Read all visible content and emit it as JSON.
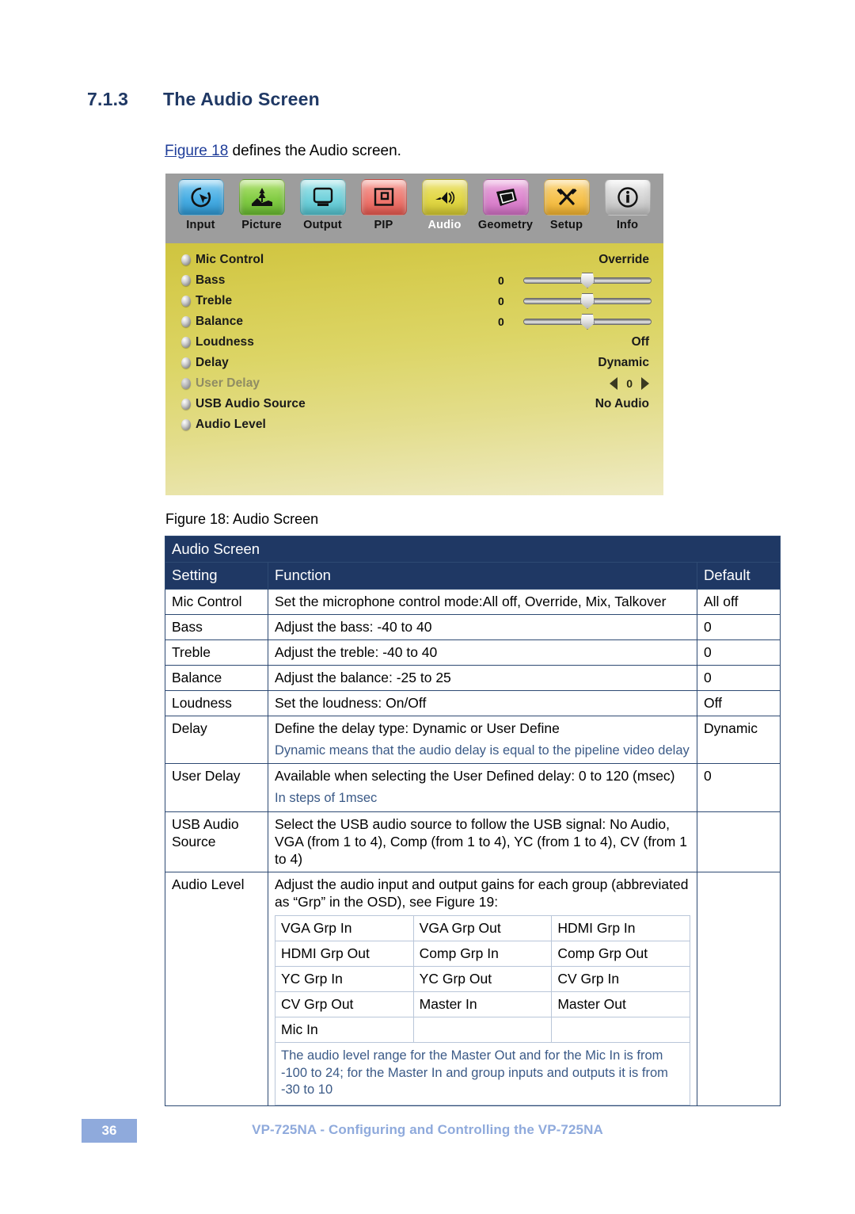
{
  "heading": {
    "number": "7.1.3",
    "title": "The Audio Screen"
  },
  "intro": {
    "link": "Figure 18",
    "rest": " defines the Audio screen."
  },
  "osd": {
    "tabs": [
      {
        "label": "Input",
        "icon": "cursor-target-icon",
        "active": false
      },
      {
        "label": "Picture",
        "icon": "landscape-tree-icon",
        "active": false
      },
      {
        "label": "Output",
        "icon": "monitor-icon",
        "active": false
      },
      {
        "label": "PIP",
        "icon": "picture-in-picture-icon",
        "active": false
      },
      {
        "label": "Audio",
        "icon": "speaker-icon",
        "active": true
      },
      {
        "label": "Geometry",
        "icon": "keystone-shape-icon",
        "active": false
      },
      {
        "label": "Setup",
        "icon": "tools-icon",
        "active": false
      },
      {
        "label": "Info",
        "icon": "info-circle-icon",
        "active": false
      }
    ],
    "rows": [
      {
        "label": "Mic Control",
        "value": "Override",
        "control": "text",
        "dim": false
      },
      {
        "label": "Bass",
        "num": "0",
        "control": "slider",
        "dim": false
      },
      {
        "label": "Treble",
        "num": "0",
        "control": "slider",
        "dim": false
      },
      {
        "label": "Balance",
        "num": "0",
        "control": "slider",
        "dim": false
      },
      {
        "label": "Loudness",
        "value": "Off",
        "control": "text",
        "dim": false
      },
      {
        "label": "Delay",
        "value": "Dynamic",
        "control": "text",
        "dim": false
      },
      {
        "label": "User Delay",
        "stepper": "0",
        "control": "stepper",
        "dim": true
      },
      {
        "label": "USB Audio Source",
        "value": "No Audio",
        "control": "text",
        "dim": false
      },
      {
        "label": "Audio Level",
        "value": "",
        "control": "none",
        "dim": false
      }
    ]
  },
  "figure_caption": "Figure 18: Audio Screen",
  "table": {
    "title": "Audio Screen",
    "headers": {
      "setting": "Setting",
      "function": "Function",
      "default": "Default"
    },
    "rows": [
      {
        "setting": "Mic Control",
        "function": "Set the microphone control mode:All off, Override, Mix, Talkover",
        "default": "All off"
      },
      {
        "setting": "Bass",
        "function": "Adjust the bass: -40 to 40",
        "default": "0"
      },
      {
        "setting": "Treble",
        "function": "Adjust the treble: -40 to 40",
        "default": "0"
      },
      {
        "setting": "Balance",
        "function": "Adjust the balance: -25 to 25",
        "default": "0"
      },
      {
        "setting": "Loudness",
        "function": "Set the loudness: On/Off",
        "default": "Off"
      },
      {
        "setting": "Delay",
        "function": "Define the delay type: Dynamic or User Define",
        "note": "Dynamic means that the audio delay is equal to the pipeline video delay",
        "default": "Dynamic"
      },
      {
        "setting": "User Delay",
        "function": "Available when selecting the User Defined delay: 0 to 120 (msec)",
        "note": "In steps of 1msec",
        "default": "0"
      },
      {
        "setting": "USB Audio Source",
        "function": "Select the USB audio source to follow the USB signal: No Audio, VGA (from 1 to 4), Comp (from 1 to 4), YC (from 1 to 4), CV (from 1 to 4)",
        "default": ""
      },
      {
        "setting": "Audio Level",
        "function": "Adjust the audio input and output gains for each group (abbreviated as “Grp” in the OSD), see Figure 19:",
        "default": ""
      }
    ],
    "audio_level_grid": [
      [
        "VGA Grp In",
        "VGA Grp Out",
        "HDMI Grp In"
      ],
      [
        "HDMI Grp Out",
        "Comp Grp In",
        "Comp Grp Out"
      ],
      [
        "YC Grp In",
        "YC Grp Out",
        "CV Grp In"
      ],
      [
        "CV Grp Out",
        "Master In",
        "Master Out"
      ],
      [
        "Mic In",
        "",
        ""
      ]
    ],
    "audio_level_note": "The audio level range for the Master Out and for the Mic In is from -100 to 24; for the Master In and group inputs and outputs it is from -30 to 10"
  },
  "footer": {
    "page": "36",
    "text": "VP-725NA - Configuring and Controlling the VP-725NA"
  },
  "colors": {
    "heading_blue": "#1f3864",
    "table_header_bg": "#1f3864",
    "note_blue": "#3b5a87",
    "footer_blue": "#8faadc",
    "link_blue": "#1f3d99"
  }
}
